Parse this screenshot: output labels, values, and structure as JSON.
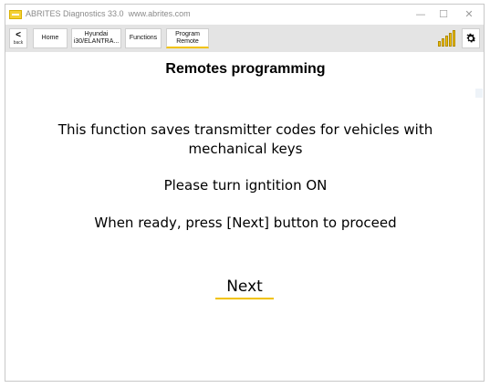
{
  "window": {
    "title": "ABRITES Diagnostics 33.0",
    "url": "www.abrites.com",
    "minimize": "—",
    "maximize": "☐",
    "close": "✕"
  },
  "toolbar": {
    "back_label": "back",
    "back_arrow": "<",
    "breadcrumbs": [
      {
        "label": "Home"
      },
      {
        "label": "Hyundai i30/ELANTRA..."
      },
      {
        "label": "Functions"
      },
      {
        "label": "Program Remote"
      }
    ]
  },
  "main": {
    "heading": "Remotes programming",
    "line1": "This function saves transmitter codes for vehicles with",
    "line2": "mechanical keys",
    "line3": "Please turn igntition ON",
    "line4": "When ready, press [Next] button to proceed",
    "next_label": "Next"
  },
  "icons": {
    "app": "abrites-logo-icon",
    "signal": "signal-strength-icon",
    "settings": "gear-icon"
  },
  "colors": {
    "accent": "#f2c200",
    "toolbar_bg": "#e4e4e4"
  }
}
